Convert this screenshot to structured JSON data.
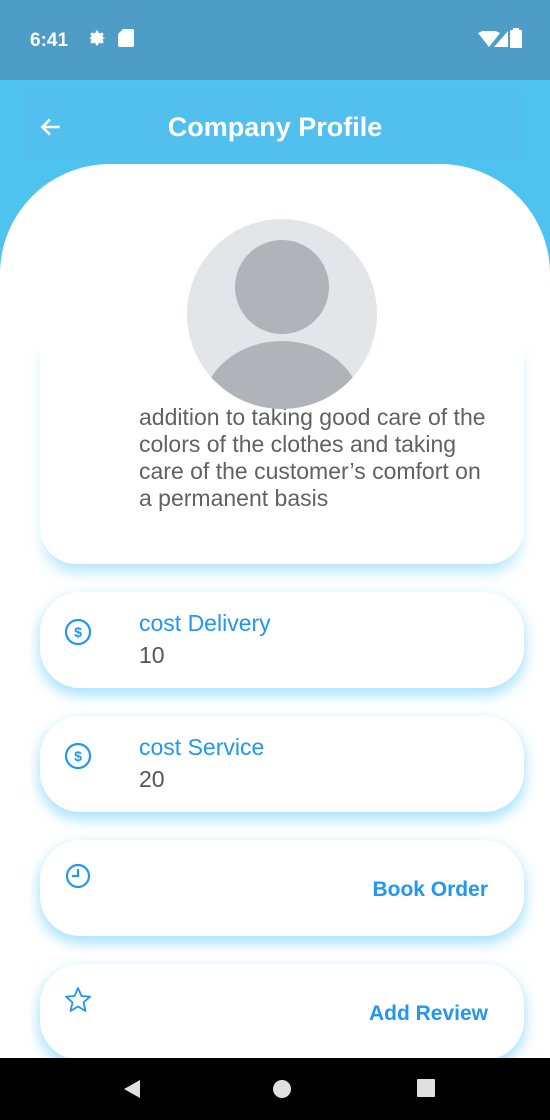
{
  "status_bar": {
    "time": "6:41",
    "icons": [
      "gear-icon",
      "sd-card-icon",
      "wifi-icon",
      "signal-icon",
      "battery-icon"
    ]
  },
  "app_bar": {
    "title": "Company Profile",
    "back_icon": "arrow-left-icon"
  },
  "profile": {
    "avatar_icon": "person-placeholder-icon",
    "description": "addition to taking good care of the colors of the clothes and taking care of the customer’s comfort on a permanent basis"
  },
  "cards": [
    {
      "icon": "dollar-circle-icon",
      "label": "cost Delivery",
      "value": "10"
    },
    {
      "icon": "dollar-circle-icon",
      "label": "cost Service",
      "value": "20"
    },
    {
      "icon": "clock-icon",
      "action": "Book Order"
    },
    {
      "icon": "star-outline-icon",
      "action": "Add Review"
    }
  ],
  "colors": {
    "status_bar": "#4e9dc6",
    "app_bar": "#4fc3f0",
    "accent": "#2196f3",
    "text_secondary": "#616161"
  },
  "nav_bar": {
    "icons": [
      "nav-back-icon",
      "nav-home-icon",
      "nav-recents-icon"
    ]
  }
}
